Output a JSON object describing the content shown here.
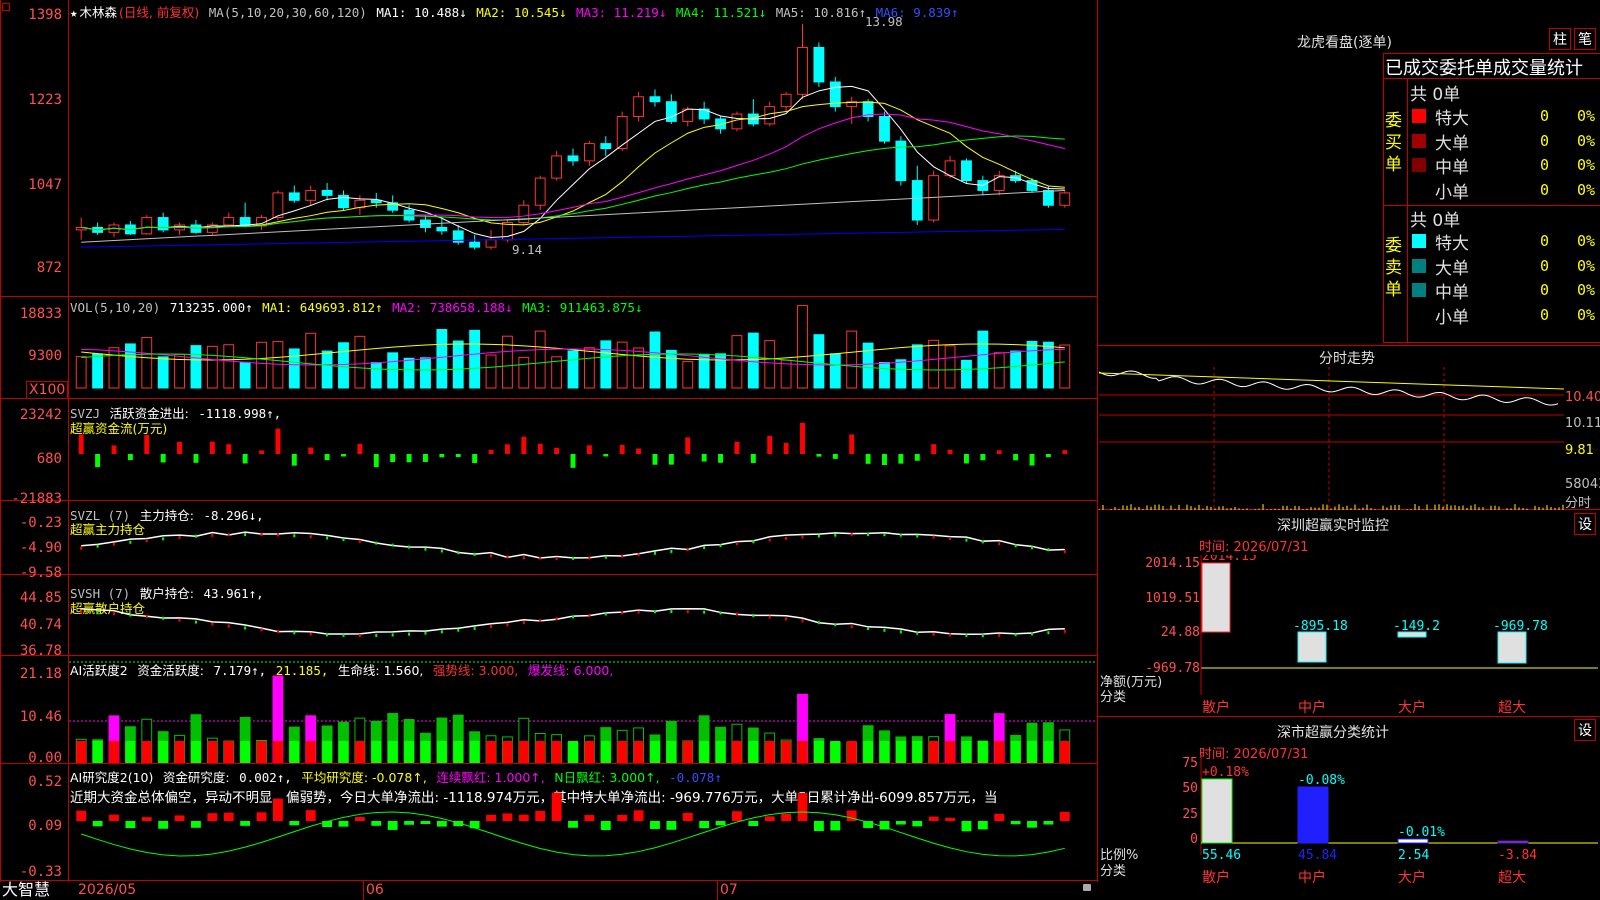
{
  "colors": {
    "up": "#ff3232",
    "down": "#00ffff",
    "frame": "#c00000",
    "ma1": "#ffffff",
    "ma2": "#ffff00",
    "ma3": "#ff00ff",
    "ma4": "#00ff00",
    "ma5": "#c0c0c0",
    "ma6": "#0000ff"
  },
  "kline": {
    "header": {
      "star": "★",
      "name": "木林森",
      "period": "(日线, 前复权)",
      "ma_params": "MA(5,10,20,30,60,120)",
      "ma1": "MA1: 10.488↓",
      "ma2": "MA2: 10.545↓",
      "ma3": "MA3: 11.219↓",
      "ma4": "MA4: 11.521↓",
      "ma5": "MA5: 10.816↑",
      "ma6": "MA6: 9.839↑"
    },
    "y_ticks": [
      "1398",
      "1223",
      "1047",
      "872"
    ],
    "high_label": "13.98",
    "low_label": "9.14"
  },
  "vol": {
    "header": {
      "params": "VOL(5,10,20)",
      "value": "713235.000↑",
      "ma1": "MA1: 649693.812↑",
      "ma2": "MA2: 738658.188↓",
      "ma3": "MA3: 911463.875↓"
    },
    "y_ticks": [
      "18833",
      "9300"
    ],
    "unit": "X100"
  },
  "svzj": {
    "header": {
      "name": "SVZJ",
      "label": "活跃资金进出:",
      "value": "-1118.998↑,"
    },
    "subtitle": "超赢资金流(万元)",
    "y_ticks": [
      "23242",
      "680",
      "-21883"
    ]
  },
  "svzl": {
    "header": {
      "name": "SVZL (7)",
      "label": "主力持仓:",
      "value": "-8.296↓,"
    },
    "subtitle": "超赢主力持仓",
    "y_ticks": [
      "-0.23",
      "-4.90",
      "-9.58"
    ]
  },
  "svsh": {
    "header": {
      "name": "SVSH (7)",
      "label": "散户持仓:",
      "value": "43.961↑,"
    },
    "subtitle": "超赢散户持仓",
    "y_ticks": [
      "44.85",
      "40.74",
      "36.78"
    ]
  },
  "ai1": {
    "header": {
      "name": "AI活跃度2",
      "label": "资金活跃度:",
      "value": "7.179↑,",
      "v2": "21.185,",
      "life": "生命线: 1.560,",
      "strong": "强势线: 3.000,",
      "burst": "爆发线: 6.000,"
    },
    "y_ticks": [
      "21.18",
      "10.46",
      "0.00"
    ]
  },
  "ai2": {
    "header": {
      "name": "AI研究度2(10)",
      "label": "资金研究度:",
      "value": "0.002↑,",
      "avg": "平均研究度: -0.078↑,",
      "red": "连续飘红: 1.000↑,",
      "nred": "N日飘红: 3.000↑,",
      "last": "-0.078↑"
    },
    "text": "近期大资金总体偏空，异动不明显，偏弱势，今日大单净流出: -1118.974万元，其中特大单净流出: -969.776万元，大单5日累计净出-6099.857万元，当",
    "y_ticks": [
      "0.52",
      "0.09",
      "-0.33"
    ]
  },
  "date_axis": {
    "brand": "大智慧",
    "labels": [
      "2026/05",
      "06",
      "07"
    ]
  },
  "lhb": {
    "title": "龙虎看盘(逐单)",
    "btn1": "柱",
    "btn2": "笔",
    "header": "已成交委托单成交量统计",
    "buy": {
      "side": "委买单",
      "total": "共 0单",
      "rows": [
        {
          "label": "特大",
          "count": "0",
          "pct": "0%",
          "color": "#ff0000"
        },
        {
          "label": "大单",
          "count": "0",
          "pct": "0%",
          "color": "#a00000"
        },
        {
          "label": "中单",
          "count": "0",
          "pct": "0%",
          "color": "#800000"
        },
        {
          "label": "小单",
          "count": "0",
          "pct": "0%",
          "color": ""
        }
      ]
    },
    "sell": {
      "side": "委卖单",
      "total": "共 0单",
      "rows": [
        {
          "label": "特大",
          "count": "0",
          "pct": "0%",
          "color": "#00ffff"
        },
        {
          "label": "大单",
          "count": "0",
          "pct": "0%",
          "color": "#008080"
        },
        {
          "label": "中单",
          "count": "0",
          "pct": "0%",
          "color": "#008080"
        },
        {
          "label": "小单",
          "count": "0",
          "pct": "0%",
          "color": ""
        }
      ]
    }
  },
  "intraday": {
    "title": "分时走势",
    "ticks": [
      "10.40",
      "10.11",
      "9.81",
      "58043"
    ],
    "vol_label": "分时"
  },
  "sz_monitor": {
    "title": "深圳超赢实时监控",
    "btn": "设",
    "time": "时间: 2026/07/31",
    "y_ticks": [
      "2014.15",
      "1019.51",
      "24.88",
      "-969.78"
    ],
    "axis_label1": "净额(万元)",
    "axis_label2": "分类",
    "values": [
      "2014.15",
      "-895.18",
      "-149.2",
      "-969.78"
    ],
    "categories": [
      "散户",
      "中户",
      "大户",
      "超大"
    ]
  },
  "sz_class": {
    "title": "深市超赢分类统计",
    "btn": "设",
    "time": "时间: 2026/07/31",
    "y_ticks": [
      "75",
      "50",
      "25",
      "0"
    ],
    "axis_label1": "比例%",
    "axis_label2": "分类",
    "changes": [
      "+0.18%",
      "-0.08%",
      "-0.01%"
    ],
    "values": [
      "55.46",
      "45.84",
      "2.54",
      "-3.84"
    ],
    "categories": [
      "散户",
      "中户",
      "大户",
      "超大"
    ]
  },
  "chart_data": {
    "type": "candlestick",
    "title": "木林森",
    "series": [
      {
        "name": "K",
        "ohlc": [
          [
            9.8,
            10.05,
            9.6,
            9.85
          ],
          [
            9.85,
            9.95,
            9.7,
            9.75
          ],
          [
            9.75,
            9.95,
            9.65,
            9.9
          ],
          [
            9.9,
            9.98,
            9.7,
            9.72
          ],
          [
            9.72,
            10.1,
            9.7,
            10.05
          ],
          [
            10.05,
            10.15,
            9.75,
            9.8
          ],
          [
            9.8,
            9.95,
            9.7,
            9.9
          ],
          [
            9.9,
            10.0,
            9.72,
            9.75
          ],
          [
            9.75,
            9.95,
            9.7,
            9.9
          ],
          [
            9.9,
            10.15,
            9.85,
            10.05
          ],
          [
            10.05,
            10.35,
            9.85,
            9.88
          ],
          [
            9.88,
            10.1,
            9.8,
            10.05
          ],
          [
            10.05,
            10.6,
            10.0,
            10.55
          ],
          [
            10.55,
            10.7,
            10.35,
            10.4
          ],
          [
            10.4,
            10.7,
            10.3,
            10.6
          ],
          [
            10.6,
            10.75,
            10.4,
            10.5
          ],
          [
            10.5,
            10.6,
            10.2,
            10.25
          ],
          [
            10.25,
            10.5,
            10.1,
            10.4
          ],
          [
            10.4,
            10.55,
            10.25,
            10.35
          ],
          [
            10.35,
            10.5,
            10.15,
            10.2
          ],
          [
            10.2,
            10.3,
            9.95,
            10.0
          ],
          [
            10.0,
            10.1,
            9.75,
            9.85
          ],
          [
            9.85,
            10.05,
            9.7,
            9.78
          ],
          [
            9.78,
            9.9,
            9.5,
            9.55
          ],
          [
            9.55,
            9.7,
            9.4,
            9.45
          ],
          [
            9.45,
            9.8,
            9.4,
            9.6
          ],
          [
            9.6,
            10.0,
            9.55,
            9.95
          ],
          [
            9.95,
            10.4,
            9.9,
            10.3
          ],
          [
            10.3,
            10.9,
            10.2,
            10.85
          ],
          [
            10.85,
            11.4,
            10.8,
            11.3
          ],
          [
            11.3,
            11.45,
            11.1,
            11.2
          ],
          [
            11.2,
            11.6,
            11.1,
            11.55
          ],
          [
            11.55,
            11.7,
            11.3,
            11.45
          ],
          [
            11.45,
            12.2,
            11.4,
            12.1
          ],
          [
            12.1,
            12.6,
            12.0,
            12.5
          ],
          [
            12.5,
            12.65,
            12.3,
            12.4
          ],
          [
            12.4,
            12.55,
            11.95,
            12.0
          ],
          [
            12.0,
            12.3,
            11.9,
            12.25
          ],
          [
            12.25,
            12.4,
            11.95,
            12.05
          ],
          [
            12.05,
            12.1,
            11.75,
            11.85
          ],
          [
            11.85,
            12.2,
            11.8,
            12.15
          ],
          [
            12.15,
            12.45,
            11.9,
            11.95
          ],
          [
            11.95,
            12.4,
            11.9,
            12.3
          ],
          [
            12.3,
            12.6,
            12.2,
            12.55
          ],
          [
            12.55,
            13.98,
            12.45,
            13.5
          ],
          [
            13.5,
            13.6,
            12.7,
            12.8
          ],
          [
            12.8,
            12.9,
            12.2,
            12.3
          ],
          [
            12.3,
            12.5,
            11.95,
            12.4
          ],
          [
            12.4,
            12.45,
            12.0,
            12.1
          ],
          [
            12.1,
            12.2,
            11.55,
            11.6
          ],
          [
            11.6,
            11.7,
            10.7,
            10.8
          ],
          [
            10.8,
            11.1,
            9.9,
            10.0
          ],
          [
            10.0,
            11.0,
            9.95,
            10.9
          ],
          [
            10.9,
            11.3,
            10.85,
            11.2
          ],
          [
            11.2,
            11.25,
            10.75,
            10.8
          ],
          [
            10.8,
            10.9,
            10.5,
            10.6
          ],
          [
            10.6,
            11.0,
            10.5,
            10.9
          ],
          [
            10.9,
            11.0,
            10.75,
            10.8
          ],
          [
            10.8,
            10.85,
            10.55,
            10.6
          ],
          [
            10.6,
            10.7,
            10.25,
            10.3
          ],
          [
            10.3,
            10.6,
            10.25,
            10.55
          ]
        ]
      }
    ],
    "ylim": [
      8.5,
      14.3
    ]
  }
}
